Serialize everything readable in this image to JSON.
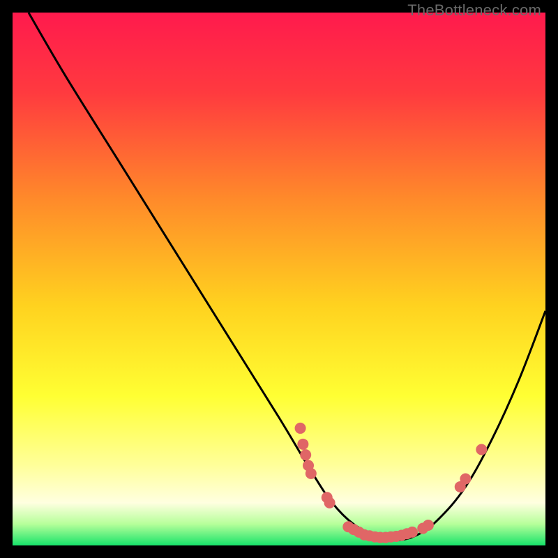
{
  "watermark": "TheBottleneck.com",
  "chart_data": {
    "type": "line",
    "title": "",
    "xlabel": "",
    "ylabel": "",
    "xlim": [
      0,
      100
    ],
    "ylim": [
      0,
      100
    ],
    "curve": {
      "name": "bottleneck-curve",
      "x": [
        3,
        10,
        20,
        30,
        40,
        50,
        56,
        60,
        64,
        68,
        72,
        76,
        80,
        85,
        90,
        95,
        100
      ],
      "y": [
        100,
        88,
        72,
        56,
        40,
        24,
        14,
        8,
        4,
        2,
        1,
        2,
        5,
        11,
        20,
        31,
        44
      ]
    },
    "scatter": {
      "name": "data-points",
      "points": [
        {
          "x": 54.0,
          "y": 22.0
        },
        {
          "x": 54.5,
          "y": 19.0
        },
        {
          "x": 55.0,
          "y": 17.0
        },
        {
          "x": 55.5,
          "y": 15.0
        },
        {
          "x": 56.0,
          "y": 13.5
        },
        {
          "x": 59.0,
          "y": 9.0
        },
        {
          "x": 59.5,
          "y": 8.0
        },
        {
          "x": 63.0,
          "y": 3.5
        },
        {
          "x": 64.0,
          "y": 3.0
        },
        {
          "x": 65.0,
          "y": 2.5
        },
        {
          "x": 66.0,
          "y": 2.0
        },
        {
          "x": 67.0,
          "y": 1.8
        },
        {
          "x": 68.0,
          "y": 1.6
        },
        {
          "x": 69.0,
          "y": 1.5
        },
        {
          "x": 70.0,
          "y": 1.5
        },
        {
          "x": 71.0,
          "y": 1.6
        },
        {
          "x": 72.0,
          "y": 1.7
        },
        {
          "x": 73.0,
          "y": 1.9
        },
        {
          "x": 74.0,
          "y": 2.2
        },
        {
          "x": 75.0,
          "y": 2.5
        },
        {
          "x": 77.0,
          "y": 3.2
        },
        {
          "x": 78.0,
          "y": 3.8
        },
        {
          "x": 84.0,
          "y": 11.0
        },
        {
          "x": 85.0,
          "y": 12.5
        },
        {
          "x": 88.0,
          "y": 18.0
        }
      ]
    },
    "gradient_stops": [
      {
        "offset": 0.0,
        "color": "#ff1a4d"
      },
      {
        "offset": 0.15,
        "color": "#ff3a3f"
      },
      {
        "offset": 0.35,
        "color": "#ff8a2a"
      },
      {
        "offset": 0.55,
        "color": "#ffd21f"
      },
      {
        "offset": 0.72,
        "color": "#ffff33"
      },
      {
        "offset": 0.85,
        "color": "#ffff9a"
      },
      {
        "offset": 0.92,
        "color": "#ffffe0"
      },
      {
        "offset": 0.96,
        "color": "#b6ff9a"
      },
      {
        "offset": 1.0,
        "color": "#17e36a"
      }
    ],
    "marker_color": "#e06666",
    "marker_radius": 8
  }
}
